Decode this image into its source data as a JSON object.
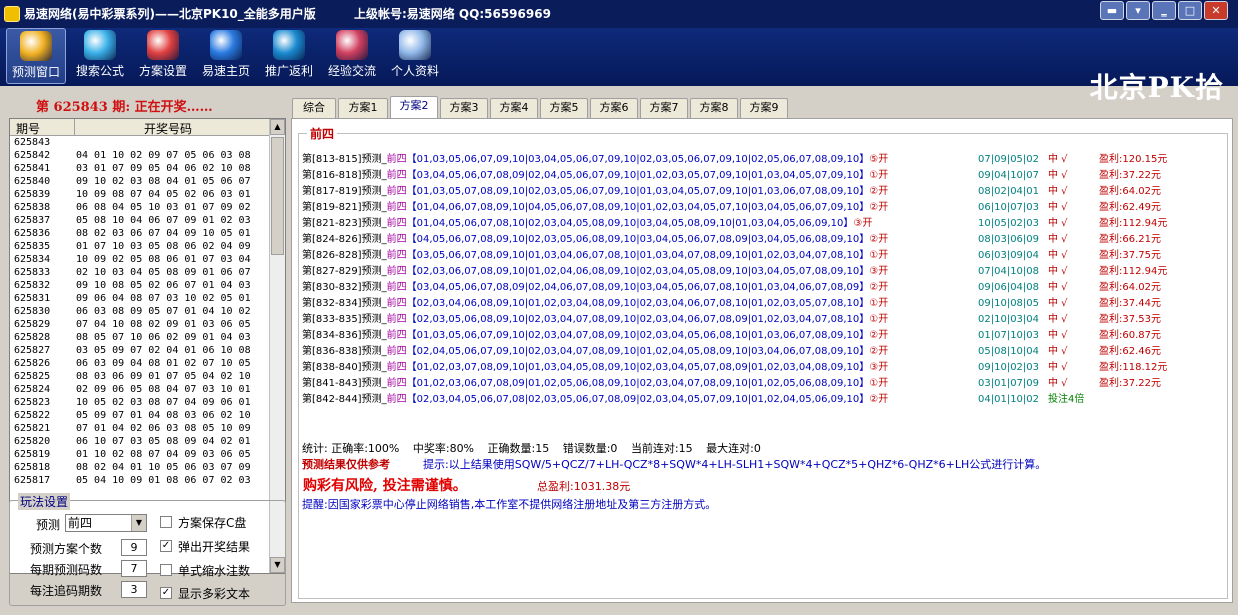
{
  "window": {
    "title": "易速网络(易中彩票系列)——北京PK10_全能多用户版",
    "account": "上级帐号:易速网络 QQ:56596969",
    "brand": "北京PK拾",
    "buttons": [
      "▬",
      "▾",
      "‗",
      "□",
      "✕"
    ]
  },
  "toolbar": [
    {
      "label": "预测窗口",
      "icon": "predict-window-icon",
      "color": "#f0b020"
    },
    {
      "label": "搜索公式",
      "icon": "search-formula-icon",
      "color": "#3ab0e8"
    },
    {
      "label": "方案设置",
      "icon": "scheme-settings-icon",
      "color": "#e04040"
    },
    {
      "label": "易速主页",
      "icon": "ie-home-icon",
      "color": "#2a7ae0"
    },
    {
      "label": "推广返利",
      "icon": "promo-rebate-icon",
      "color": "#1a8ad0"
    },
    {
      "label": "经验交流",
      "icon": "exchange-icon",
      "color": "#d04060"
    },
    {
      "label": "个人资料",
      "icon": "profile-icon",
      "color": "#90b8e8"
    }
  ],
  "left": {
    "status": "第 625843 期: 正在开奖……",
    "headers": [
      "期号",
      "开奖号码"
    ],
    "rows": [
      [
        "625843",
        ""
      ],
      [
        "625842",
        "04 01 10 02 09 07 05 06 03 08"
      ],
      [
        "625841",
        "03 01 07 09 05 04 06 02 10 08"
      ],
      [
        "625840",
        "09 10 02 03 08 04 01 05 06 07"
      ],
      [
        "625839",
        "10 09 08 07 04 05 02 06 03 01"
      ],
      [
        "625838",
        "06 08 04 05 10 03 01 07 09 02"
      ],
      [
        "625837",
        "05 08 10 04 06 07 09 01 02 03"
      ],
      [
        "625836",
        "08 02 03 06 07 04 09 10 05 01"
      ],
      [
        "625835",
        "01 07 10 03 05 08 06 02 04 09"
      ],
      [
        "625834",
        "10 09 02 05 08 06 01 07 03 04"
      ],
      [
        "625833",
        "02 10 03 04 05 08 09 01 06 07"
      ],
      [
        "625832",
        "09 10 08 05 02 06 07 01 04 03"
      ],
      [
        "625831",
        "09 06 04 08 07 03 10 02 05 01"
      ],
      [
        "625830",
        "06 03 08 09 05 07 01 04 10 02"
      ],
      [
        "625829",
        "07 04 10 08 02 09 01 03 06 05"
      ],
      [
        "625828",
        "08 05 07 10 06 02 09 01 04 03"
      ],
      [
        "625827",
        "03 05 09 07 02 04 01 06 10 08"
      ],
      [
        "625826",
        "06 03 09 04 08 01 02 07 10 05"
      ],
      [
        "625825",
        "08 03 06 09 01 07 05 04 02 10"
      ],
      [
        "625824",
        "02 09 06 05 08 04 07 03 10 01"
      ],
      [
        "625823",
        "10 05 02 03 08 07 04 09 06 01"
      ],
      [
        "625822",
        "05 09 07 01 04 08 03 06 02 10"
      ],
      [
        "625821",
        "07 01 04 02 06 03 08 05 10 09"
      ],
      [
        "625820",
        "06 10 07 03 05 08 09 04 02 01"
      ],
      [
        "625819",
        "01 10 02 08 07 04 09 03 06 05"
      ],
      [
        "625818",
        "08 02 04 01 10 05 06 03 07 09"
      ],
      [
        "625817",
        "05 04 10 09 01 08 06 07 02 03"
      ]
    ]
  },
  "settings": {
    "legend": "玩法设置",
    "predict_label": "预测",
    "predict_value": "前四",
    "scheme_count_label": "预测方案个数",
    "scheme_count": "9",
    "codes_label": "每期预测码数",
    "codes": "7",
    "chase_label": "每注追码期数",
    "chase": "3",
    "opts": [
      {
        "label": "方案保存C盘",
        "checked": false
      },
      {
        "label": "弹出开奖结果",
        "checked": true
      },
      {
        "label": "单式缩水注数",
        "checked": false
      },
      {
        "label": "显示多彩文本",
        "checked": true
      }
    ],
    "check_mark": "✓"
  },
  "tabs": [
    "综合",
    "方案1",
    "方案2",
    "方案3",
    "方案4",
    "方案5",
    "方案6",
    "方案7",
    "方案8",
    "方案9"
  ],
  "active_tab": 2,
  "main": {
    "group_title": "前四",
    "lines": [
      {
        "r": "第[813-815]预测_",
        "pos": "前四",
        "n": "【01,03,05,06,07,09,10|03,04,05,06,07,09,10|02,03,05,06,07,09,10|02,05,06,07,08,09,10】",
        "res": "⑤开",
        "d": "07|09|05|02",
        "v": "中 √",
        "p": "盈利:120.15元"
      },
      {
        "r": "第[816-818]预测_",
        "pos": "前四",
        "n": "【03,04,05,06,07,08,09|02,04,05,06,07,09,10|01,02,03,05,07,09,10|01,03,04,05,07,09,10】",
        "res": "①开",
        "d": "09|04|10|07",
        "v": "中 √",
        "p": "盈利:37.22元"
      },
      {
        "r": "第[817-819]预测_",
        "pos": "前四",
        "n": "【01,03,05,07,08,09,10|02,03,05,06,07,09,10|01,03,04,05,07,09,10|01,03,06,07,08,09,10】",
        "res": "②开",
        "d": "08|02|04|01",
        "v": "中 √",
        "p": "盈利:64.02元"
      },
      {
        "r": "第[819-821]预测_",
        "pos": "前四",
        "n": "【01,04,06,07,08,09,10|04,05,06,07,08,09,10|01,02,03,04,05,07,10|03,04,05,06,07,09,10】",
        "res": "②开",
        "d": "06|10|07|03",
        "v": "中 √",
        "p": "盈利:62.49元"
      },
      {
        "r": "第[821-823]预测_",
        "pos": "前四",
        "n": "【01,04,05,06,07,08,10|02,03,04,05,08,09,10|03,04,05,08,09,10|01,03,04,05,06,09,10】",
        "res": "③开",
        "d": "10|05|02|03",
        "v": "中 √",
        "p": "盈利:112.94元"
      },
      {
        "r": "第[824-826]预测_",
        "pos": "前四",
        "n": "【04,05,06,07,08,09,10|02,03,05,06,08,09,10|03,04,05,06,07,08,09|03,04,05,06,08,09,10】",
        "res": "②开",
        "d": "08|03|06|09",
        "v": "中 √",
        "p": "盈利:66.21元"
      },
      {
        "r": "第[826-828]预测_",
        "pos": "前四",
        "n": "【03,05,06,07,08,09,10|01,03,04,06,07,08,10|01,03,04,07,08,09,10|01,02,03,04,07,08,10】",
        "res": "①开",
        "d": "06|03|09|04",
        "v": "中 √",
        "p": "盈利:37.75元"
      },
      {
        "r": "第[827-829]预测_",
        "pos": "前四",
        "n": "【02,03,06,07,08,09,10|01,02,04,06,08,09,10|02,03,04,05,08,09,10|03,04,05,07,08,09,10】",
        "res": "③开",
        "d": "07|04|10|08",
        "v": "中 √",
        "p": "盈利:112.94元"
      },
      {
        "r": "第[830-832]预测_",
        "pos": "前四",
        "n": "【03,04,05,06,07,08,09|02,04,06,07,08,09,10|03,04,05,06,07,08,10|01,03,04,06,07,08,09】",
        "res": "②开",
        "d": "09|06|04|08",
        "v": "中 √",
        "p": "盈利:64.02元"
      },
      {
        "r": "第[832-834]预测_",
        "pos": "前四",
        "n": "【02,03,04,06,08,09,10|01,02,03,04,08,09,10|02,03,04,06,07,08,10|01,02,03,05,07,08,10】",
        "res": "①开",
        "d": "09|10|08|05",
        "v": "中 √",
        "p": "盈利:37.44元"
      },
      {
        "r": "第[833-835]预测_",
        "pos": "前四",
        "n": "【02,03,05,06,08,09,10|02,03,04,07,08,09,10|02,03,04,06,07,08,09|01,02,03,04,07,08,10】",
        "res": "①开",
        "d": "02|10|03|04",
        "v": "中 √",
        "p": "盈利:37.53元"
      },
      {
        "r": "第[834-836]预测_",
        "pos": "前四",
        "n": "【01,03,05,06,07,09,10|02,03,04,07,08,09,10|02,03,04,05,06,08,10|01,03,06,07,08,09,10】",
        "res": "②开",
        "d": "01|07|10|03",
        "v": "中 √",
        "p": "盈利:60.87元"
      },
      {
        "r": "第[836-838]预测_",
        "pos": "前四",
        "n": "【02,04,05,06,07,09,10|02,03,04,07,08,09,10|01,02,04,05,08,09,10|03,04,06,07,08,09,10】",
        "res": "②开",
        "d": "05|08|10|04",
        "v": "中 √",
        "p": "盈利:62.46元"
      },
      {
        "r": "第[838-840]预测_",
        "pos": "前四",
        "n": "【01,02,03,07,08,09,10|01,03,04,05,08,09,10|02,03,04,05,07,08,09|01,02,03,04,08,09,10】",
        "res": "③开",
        "d": "09|10|02|03",
        "v": "中 √",
        "p": "盈利:118.12元"
      },
      {
        "r": "第[841-843]预测_",
        "pos": "前四",
        "n": "【01,02,03,06,07,08,09|01,02,05,06,08,09,10|02,03,04,07,08,09,10|01,02,05,06,08,09,10】",
        "res": "①开",
        "d": "03|01|07|09",
        "v": "中 √",
        "p": "盈利:37.22元"
      },
      {
        "r": "第[842-844]预测_",
        "pos": "前四",
        "n": "【02,03,04,05,06,07,08|02,03,05,06,07,08,09|02,03,04,05,07,09,10|01,02,04,05,06,09,10】",
        "res": "②开",
        "d": "04|01|10|02",
        "v": "投注4倍",
        "p": ""
      }
    ],
    "stats": [
      "统计: 正确率:100%",
      "中奖率:80%",
      "正确数量:15",
      "错误数量:0",
      "当前连对:15",
      "最大连对:0"
    ],
    "ref_note": "预测结果仅供参考",
    "hint": "提示:以上结果使用SQW/5+QCZ/7+LH-QCZ*8+SQW*4+LH-SLH1+SQW*4+QCZ*5+QHZ*6-QHZ*6+LH公式进行计算。",
    "risk": "购彩有风险, 投注需谨慎。",
    "total_profit": "总盈利:1031.38元",
    "reminder": "提醒:因国家彩票中心停止网络销售,本工作室不提供网络注册地址及第三方注册方式。"
  }
}
